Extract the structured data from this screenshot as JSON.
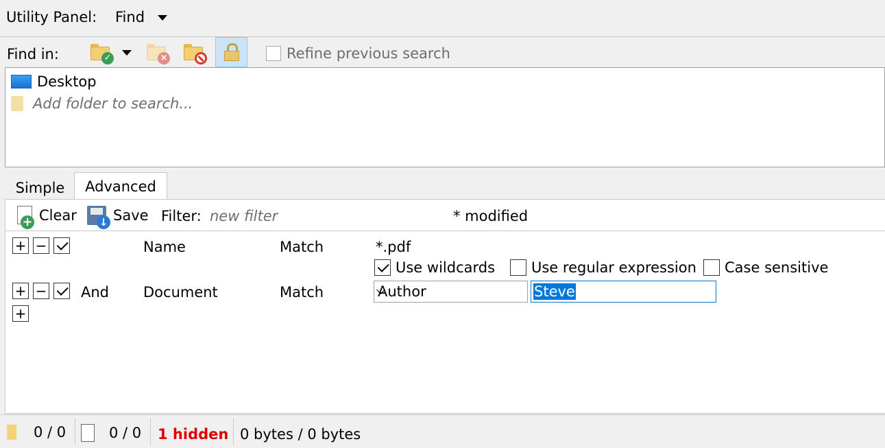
{
  "header": {
    "title": "Utility Panel:",
    "mode": "Find"
  },
  "findbar": {
    "label": "Find in:",
    "refine_label": "Refine previous search"
  },
  "folders": {
    "items": [
      {
        "name": "Desktop",
        "icon": "monitor-icon"
      }
    ],
    "add_placeholder": "Add folder to search..."
  },
  "tabs": [
    {
      "label": "Simple"
    },
    {
      "label": "Advanced",
      "active": true
    }
  ],
  "advanced": {
    "toolbar": {
      "clear_label": "Clear",
      "save_label": "Save",
      "filter_label": "Filter:",
      "filter_placeholder": "new filter",
      "modified": "* modified"
    },
    "rows": [
      {
        "conjunction": "",
        "field": "Name",
        "operator": "Match",
        "value": "*.pdf",
        "checked": true,
        "options": [
          {
            "label": "Use wildcards",
            "checked": true
          },
          {
            "label": "Use regular expression",
            "checked": false
          },
          {
            "label": "Case sensitive",
            "checked": false
          }
        ]
      },
      {
        "conjunction": "And",
        "field": "Document",
        "operator": "Match",
        "property": "Author",
        "value": "Steve",
        "checked": true
      }
    ]
  },
  "status": {
    "folders": "0 / 0",
    "files": "0 / 0",
    "hidden": "1 hidden",
    "size": "0 bytes / 0 bytes"
  },
  "colors": {
    "accent": "#0078d7",
    "hidden": "#e00000",
    "selected_tool": "#cce4f7"
  }
}
